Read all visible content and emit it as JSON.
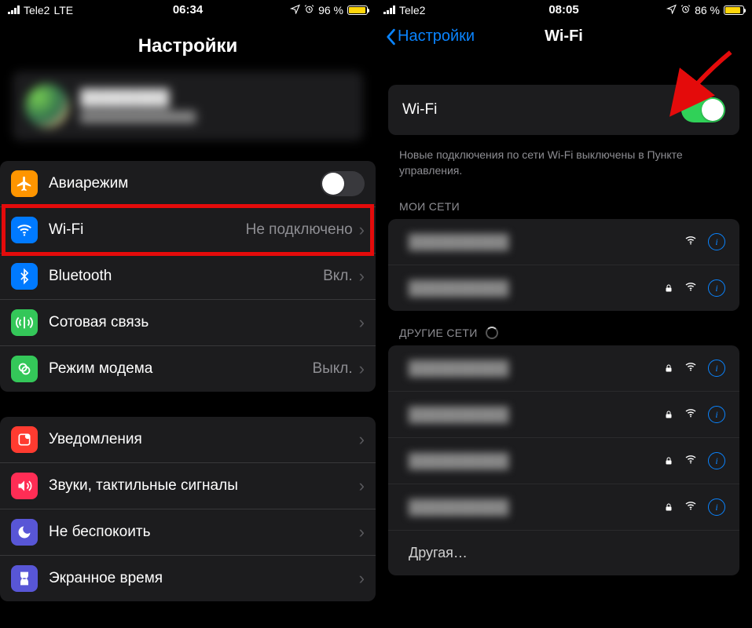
{
  "left": {
    "status": {
      "carrier": "Tele2",
      "net": "LTE",
      "time": "06:34",
      "battery_pct": "96 %",
      "battery_fill_pct": 96
    },
    "title": "Настройки",
    "rows_conn": [
      {
        "id": "airplane",
        "label": "Авиарежим",
        "type": "toggle",
        "toggle_on": false,
        "icon_color": "#ff9500"
      },
      {
        "id": "wifi",
        "label": "Wi-Fi",
        "value": "Не подключено",
        "type": "link",
        "icon_color": "#007aff",
        "highlighted": true
      },
      {
        "id": "bluetooth",
        "label": "Bluetooth",
        "value": "Вкл.",
        "type": "link",
        "icon_color": "#007aff"
      },
      {
        "id": "cellular",
        "label": "Сотовая связь",
        "value": "",
        "type": "link",
        "icon_color": "#34c759"
      },
      {
        "id": "hotspot",
        "label": "Режим модема",
        "value": "Выкл.",
        "type": "link",
        "icon_color": "#34c759"
      }
    ],
    "rows_general": [
      {
        "id": "notifications",
        "label": "Уведомления",
        "icon_color": "#ff3b30"
      },
      {
        "id": "sounds",
        "label": "Звуки, тактильные сигналы",
        "icon_color": "#ff2d55"
      },
      {
        "id": "dnd",
        "label": "Не беспокоить",
        "icon_color": "#5856d6"
      },
      {
        "id": "screentime",
        "label": "Экранное время",
        "icon_color": "#5856d6"
      }
    ]
  },
  "right": {
    "status": {
      "carrier": "Tele2",
      "net": "",
      "time": "08:05",
      "battery_pct": "86 %",
      "battery_fill_pct": 86
    },
    "back": "Настройки",
    "title": "Wi-Fi",
    "wifi_label": "Wi-Fi",
    "wifi_on": true,
    "note": "Новые подключения по сети Wi-Fi выключены в Пункте управления.",
    "my_networks_label": "МОИ СЕТИ",
    "other_networks_label": "ДРУГИЕ СЕТИ",
    "other_label": "Другая…",
    "my_networks": [
      {
        "locked": false
      },
      {
        "locked": true
      }
    ],
    "other_networks": [
      {
        "locked": true
      },
      {
        "locked": true
      },
      {
        "locked": true
      },
      {
        "locked": true
      }
    ]
  }
}
